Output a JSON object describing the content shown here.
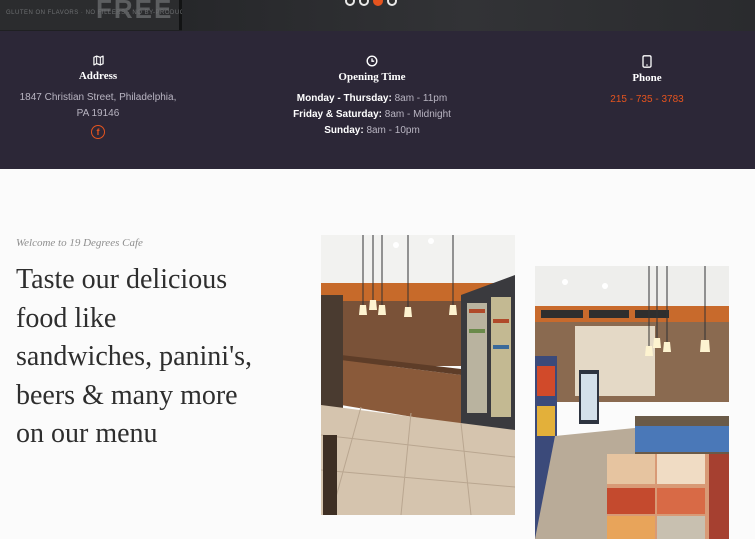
{
  "hero": {
    "sign_big": "FREE",
    "sign_small": "GLUTEN ON FLAVORS · NO FILLERS · NO BY-PRODUCTS",
    "slides": 4,
    "active_slide": 3
  },
  "info": {
    "address": {
      "icon": "map-icon",
      "title": "Address",
      "line1": "1847 Christian Street, Philadelphia,",
      "line2": "PA 19146",
      "facebook_icon": "facebook-icon"
    },
    "hours": {
      "icon": "clock-icon",
      "title": "Opening Time",
      "rows": [
        {
          "days": "Monday - Thursday:",
          "time": "8am - 11pm"
        },
        {
          "days": "Friday & Saturday:",
          "time": "8am - Midnight"
        },
        {
          "days": "Sunday:",
          "time": "8am - 10pm"
        }
      ]
    },
    "phone": {
      "icon": "phone-icon",
      "title": "Phone",
      "number": "215 - 735 - 3783"
    }
  },
  "welcome": {
    "label": "Welcome to 19 Degrees Cafe",
    "headline_lines": [
      "Taste our delicious",
      "food like",
      "sandwiches, panini's,",
      "beers & many more",
      "on our menu"
    ]
  },
  "colors": {
    "accent": "#e5541f",
    "info_bg": "#2c2737",
    "page_bg": "#fbfbfb"
  }
}
